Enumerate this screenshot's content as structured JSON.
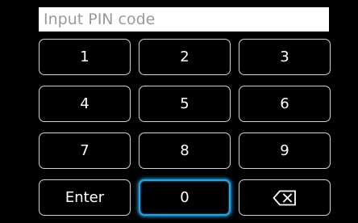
{
  "pin_entry": {
    "placeholder": "Input PIN code",
    "value": ""
  },
  "keypad": {
    "keys": [
      {
        "label": "1"
      },
      {
        "label": "2"
      },
      {
        "label": "3"
      },
      {
        "label": "4"
      },
      {
        "label": "5"
      },
      {
        "label": "6"
      },
      {
        "label": "7"
      },
      {
        "label": "8"
      },
      {
        "label": "9"
      },
      {
        "label": "Enter"
      },
      {
        "label": "0",
        "focused": true
      },
      {
        "icon": "backspace-icon"
      }
    ]
  },
  "colors": {
    "background": "#000000",
    "key_border": "#cfd3d6",
    "focus_ring": "#2aa2df",
    "input_background": "#ffffff",
    "placeholder_text": "#9a9a9a"
  }
}
